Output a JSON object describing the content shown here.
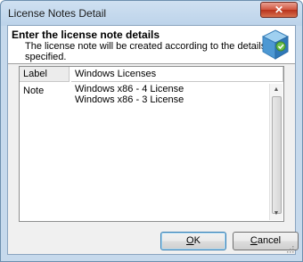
{
  "window": {
    "title": "License Notes Detail",
    "close_glyph": "✕"
  },
  "header": {
    "title": "Enter the license note details",
    "subtitle": "The license note will be created according to the details specified.",
    "icon": "license-cube-icon"
  },
  "form": {
    "label_field": {
      "label": "Label",
      "value": "Windows Licenses"
    },
    "note_field": {
      "label": "Note",
      "lines": [
        "Windows x86 - 4 License",
        "Windows x86 - 3 License"
      ]
    }
  },
  "buttons": {
    "ok_label": "OK",
    "ok_mnemonic": "O",
    "ok_rest": "K",
    "cancel_label": "Cancel",
    "cancel_mnemonic": "C",
    "cancel_rest": "ancel"
  },
  "colors": {
    "accent": "#3c7fb1",
    "close_red": "#c8462e"
  }
}
